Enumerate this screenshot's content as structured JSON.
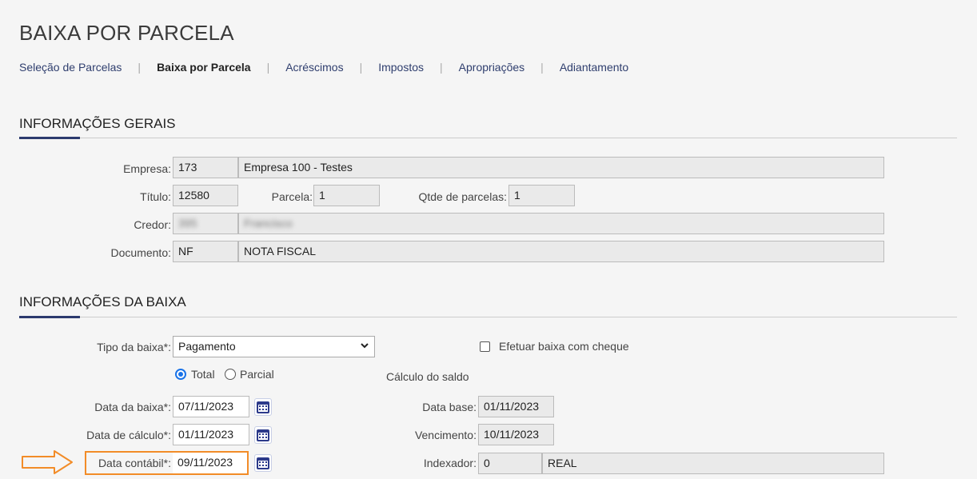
{
  "page_title": "BAIXA POR PARCELA",
  "tabs": [
    {
      "label": "Seleção de Parcelas"
    },
    {
      "label": "Baixa por Parcela"
    },
    {
      "label": "Acréscimos"
    },
    {
      "label": "Impostos"
    },
    {
      "label": "Apropriações"
    },
    {
      "label": "Adiantamento"
    }
  ],
  "active_tab": "Baixa por Parcela",
  "gerais": {
    "title": "INFORMAÇÕES GERAIS",
    "empresa": {
      "label": "Empresa:",
      "code": "173",
      "name": "Empresa 100 - Testes"
    },
    "titulo": {
      "label": "Título:",
      "value": "12580"
    },
    "parcela": {
      "label": "Parcela:",
      "value": "1"
    },
    "qtde": {
      "label": "Qtde de parcelas:",
      "value": "1"
    },
    "credor": {
      "label": "Credor:",
      "code": "395",
      "name": "Francisco"
    },
    "documento": {
      "label": "Documento:",
      "code": "NF",
      "name": "NOTA FISCAL"
    }
  },
  "baixa": {
    "title": "INFORMAÇÕES DA BAIXA",
    "tipo": {
      "label": "Tipo da baixa*:",
      "value": "Pagamento"
    },
    "cheque": {
      "label": "Efetuar baixa com cheque",
      "checked": false
    },
    "radio_total": {
      "label": "Total",
      "selected": true
    },
    "radio_parcial": {
      "label": "Parcial",
      "selected": false
    },
    "calculo_title": "Cálculo do saldo",
    "data_baixa": {
      "label": "Data da baixa*:",
      "value": "07/11/2023"
    },
    "data_calculo": {
      "label": "Data de cálculo*:",
      "value": "01/11/2023"
    },
    "data_contabil": {
      "label": "Data contábil*:",
      "value": "09/11/2023"
    },
    "data_base": {
      "label": "Data base:",
      "value": "01/11/2023"
    },
    "vencimento": {
      "label": "Vencimento:",
      "value": "10/11/2023"
    },
    "indexador": {
      "label": "Indexador:",
      "code": "0",
      "name": "REAL"
    }
  },
  "colors": {
    "accent": "#2c3a6e",
    "highlight": "#f28c28",
    "radio": "#1a73e8"
  },
  "icons": {
    "calendar": "calendar-icon",
    "arrow": "arrow-right-icon",
    "dropdown": "chevron-down-icon"
  }
}
